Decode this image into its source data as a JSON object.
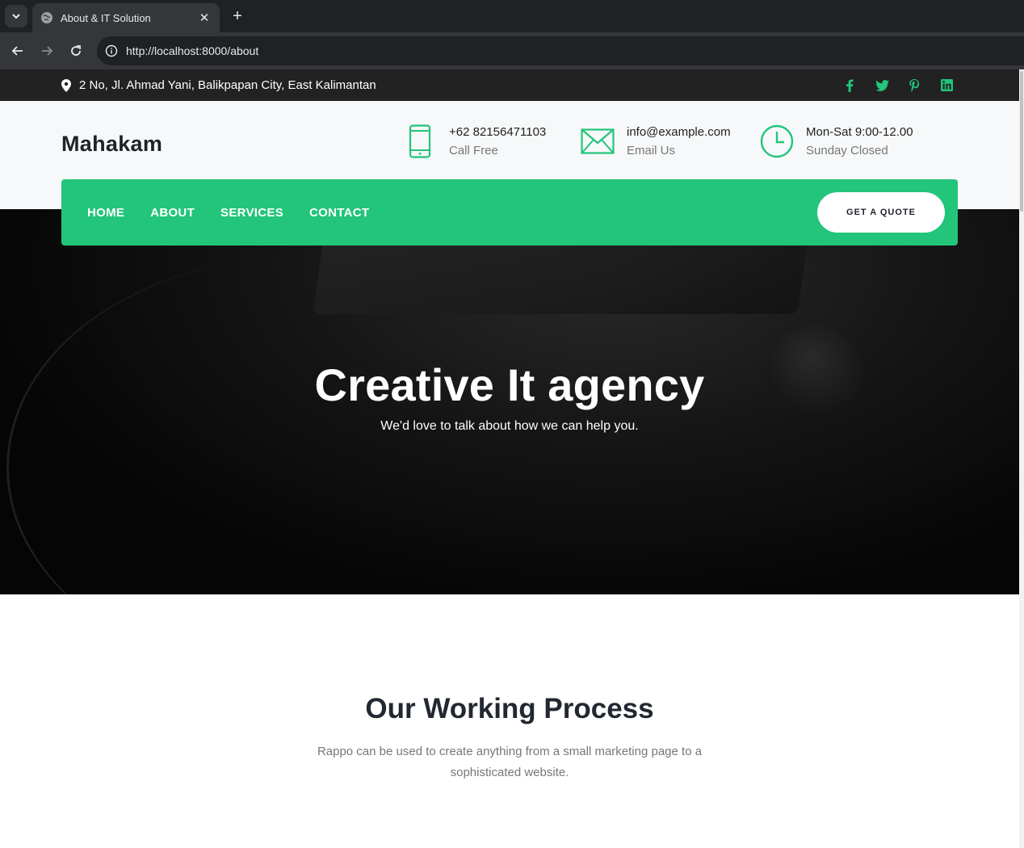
{
  "browser": {
    "tab_title": "About & IT Solution",
    "tab_close": "✕",
    "new_tab": "+",
    "url": "http://localhost:8000/about"
  },
  "topbar": {
    "address": "2 No, Jl. Ahmad Yani, Balikpapan City, East Kalimantan",
    "socials": [
      "facebook-icon",
      "twitter-icon",
      "pinterest-icon",
      "linkedin-icon"
    ]
  },
  "header": {
    "logo": "Mahakam",
    "phone": {
      "line1": "+62 82156471103",
      "line2": "Call Free",
      "icon": "phone-icon"
    },
    "email": {
      "line1": "info@example.com",
      "line2": "Email Us",
      "icon": "envelope-icon"
    },
    "hours": {
      "line1": "Mon-Sat 9:00-12.00",
      "line2": "Sunday Closed",
      "icon": "clock-icon"
    }
  },
  "nav": {
    "items": [
      "HOME",
      "ABOUT",
      "SERVICES",
      "CONTACT"
    ],
    "cta": "GET A QUOTE"
  },
  "hero": {
    "title": "Creative It agency",
    "subtitle": "We'd love to talk about how we can help you."
  },
  "process": {
    "title": "Our Working Process",
    "description": "Rappo can be used to create anything from a small marketing page to a sophisticated website."
  },
  "colors": {
    "accent": "#22c57a",
    "topbar": "#222222",
    "header_bg": "#f6f8f9"
  }
}
